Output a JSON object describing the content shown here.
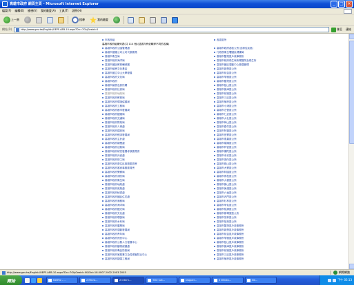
{
  "window": {
    "title": "高雄市政府 網頁主頁 - Microsoft Internet Explorer",
    "controls": [
      "_",
      "□",
      "×"
    ]
  },
  "menu": [
    "檔案(F)",
    "編輯(E)",
    "檢視(V)",
    "我的最愛(A)",
    "工具(T)",
    "說明(H)"
  ],
  "toolbar": {
    "back_label": "上一頁",
    "search_label": "搜尋",
    "favorites_label": "我的最愛"
  },
  "address": {
    "label": "網址(D)",
    "url": "http://www.gov.tw/English/OEPF-AEB-10.aspx?Dn=7GkjGeaid=0",
    "go_label": "移至",
    "links_label": "連結"
  },
  "list": {
    "left": [
      {
        "text": "市政府組",
        "style": "normal"
      },
      {
        "text": "高雄市政府組織列表(共 114 個)(括弧內有依職掌不同的名稱)",
        "style": "head"
      },
      {
        "text": "高雄市政府公園管理處",
        "style": "normal"
      },
      {
        "text": "高雄市捷運公司公司代辦委員",
        "style": "normal"
      },
      {
        "text": "高雄市衛生局",
        "style": "normal"
      },
      {
        "text": "高雄市政府海洋局",
        "style": "normal"
      },
      {
        "text": "高雄市國民教育輔導團",
        "style": "normal"
      },
      {
        "text": "高雄市議會文化基金",
        "style": "normal"
      },
      {
        "text": "高雄市國立中山大學發展",
        "style": "normal"
      },
      {
        "text": "高雄市政府文化局",
        "style": "normal"
      },
      {
        "text": "高雄市政府",
        "style": "normal"
      },
      {
        "text": "高雄市議會及其所屬",
        "style": "normal"
      },
      {
        "text": "高雄市政府社會局",
        "style": "normal"
      },
      {
        "text": "高雄市政府地政局",
        "style": "dim"
      },
      {
        "text": "高雄市政府教育局",
        "style": "normal"
      },
      {
        "text": "高雄市政府環境保護局",
        "style": "normal"
      },
      {
        "text": "高雄市政府工務局",
        "style": "normal"
      },
      {
        "text": "高雄市政府都市發展局",
        "style": "normal"
      },
      {
        "text": "高雄市政府捷運局",
        "style": "normal"
      },
      {
        "text": "高雄市政府交通局",
        "style": "normal"
      },
      {
        "text": "高雄市政府財政局",
        "style": "normal"
      },
      {
        "text": "高雄市政府人事處",
        "style": "normal"
      },
      {
        "text": "高雄市政府建設局",
        "style": "normal"
      },
      {
        "text": "高雄市政府經濟發展局",
        "style": "normal"
      },
      {
        "text": "高雄市政府主計處",
        "style": "normal"
      },
      {
        "text": "高雄市政府新聞處",
        "style": "normal"
      },
      {
        "text": "高雄市政府法制局",
        "style": "normal"
      },
      {
        "text": "高雄市政府研究發展考核委員會",
        "style": "normal"
      },
      {
        "text": "高雄市政府兵役處",
        "style": "normal"
      },
      {
        "text": "高雄市政府勞工局",
        "style": "normal"
      },
      {
        "text": "高雄市政府原住民事務委員會",
        "style": "normal"
      },
      {
        "text": "高雄市政府客家事務委員會",
        "style": "normal"
      },
      {
        "text": "高雄市政府警察局",
        "style": "normal"
      },
      {
        "text": "高雄市政府消防局",
        "style": "normal"
      },
      {
        "text": "高雄市政府衛生局",
        "style": "normal"
      },
      {
        "text": "高雄市政府地政處",
        "style": "normal"
      },
      {
        "text": "高雄市政府政風處",
        "style": "normal"
      },
      {
        "text": "高雄市政府秘書處",
        "style": "normal"
      },
      {
        "text": "高雄市政府國民住宅處",
        "style": "normal"
      },
      {
        "text": "高雄市政府港務局",
        "style": "normal"
      },
      {
        "text": "高雄市政府海洋局",
        "style": "normal"
      },
      {
        "text": "高雄市政府觀光局",
        "style": "normal"
      },
      {
        "text": "高雄市政府文化處",
        "style": "normal"
      },
      {
        "text": "高雄市政府環保局",
        "style": "normal"
      },
      {
        "text": "高雄市政府水利局",
        "style": "normal"
      },
      {
        "text": "高雄市政府農業局",
        "style": "normal"
      },
      {
        "text": "高雄市政府運動發展局",
        "style": "normal"
      },
      {
        "text": "高雄市政府青年局",
        "style": "normal"
      },
      {
        "text": "高雄市政府資訊中心",
        "style": "normal"
      },
      {
        "text": "高雄市政府公務人力發展中心",
        "style": "normal"
      },
      {
        "text": "高雄市政府動物保護處",
        "style": "normal"
      },
      {
        "text": "高雄市政府毒品防制局",
        "style": "normal"
      },
      {
        "text": "高雄市政府家庭暴力及性侵害防治中心",
        "style": "normal"
      },
      {
        "text": "高雄市政府捷運工程局",
        "style": "normal"
      }
    ],
    "right": [
      {
        "text": "各區區所",
        "style": "normal"
      },
      {
        "text": "",
        "style": "spacer"
      },
      {
        "text": "高雄市政府各區公所(含原住民區)",
        "style": "normal"
      },
      {
        "text": "行政院衛生署國民健康局",
        "style": "normal"
      },
      {
        "text": "高雄市鹽埕區戶政事務所",
        "style": "normal"
      },
      {
        "text": "高雄市政府衛生局所屬醫院及衛生所",
        "style": "normal"
      },
      {
        "text": "高雄市國民運動中心營運管理",
        "style": "normal"
      },
      {
        "text": "高雄市新興區公所",
        "style": "normal"
      },
      {
        "text": "高雄市前金區公所",
        "style": "normal"
      },
      {
        "text": "高雄市苓雅區公所",
        "style": "normal"
      },
      {
        "text": "高雄市鹽埕區公所",
        "style": "normal"
      },
      {
        "text": "高雄市鼓山區公所",
        "style": "normal"
      },
      {
        "text": "高雄市旗津區公所",
        "style": "normal"
      },
      {
        "text": "高雄市前鎮區公所",
        "style": "normal"
      },
      {
        "text": "高雄市三民區公所",
        "style": "normal"
      },
      {
        "text": "高雄市楠梓區公所",
        "style": "normal"
      },
      {
        "text": "高雄市小港區公所",
        "style": "normal"
      },
      {
        "text": "高雄市左營區公所",
        "style": "normal"
      },
      {
        "text": "高雄市仁武區公所",
        "style": "normal"
      },
      {
        "text": "高雄市大社區公所",
        "style": "normal"
      },
      {
        "text": "高雄市岡山區公所",
        "style": "normal"
      },
      {
        "text": "高雄市路竹區公所",
        "style": "normal"
      },
      {
        "text": "高雄市阿蓮區公所",
        "style": "normal"
      },
      {
        "text": "高雄市田寮區公所",
        "style": "normal"
      },
      {
        "text": "高雄市燕巢區公所",
        "style": "normal"
      },
      {
        "text": "高雄市橋頭區公所",
        "style": "normal"
      },
      {
        "text": "高雄市梓官區公所",
        "style": "normal"
      },
      {
        "text": "高雄市彌陀區公所",
        "style": "normal"
      },
      {
        "text": "高雄市永安區公所",
        "style": "normal"
      },
      {
        "text": "高雄市湖內區公所",
        "style": "normal"
      },
      {
        "text": "高雄市鳳山區公所",
        "style": "normal"
      },
      {
        "text": "高雄市大寮區公所",
        "style": "normal"
      },
      {
        "text": "高雄市林園區公所",
        "style": "normal"
      },
      {
        "text": "高雄市鳥松區公所",
        "style": "normal"
      },
      {
        "text": "高雄市大樹區公所",
        "style": "normal"
      },
      {
        "text": "高雄市旗山區公所",
        "style": "normal"
      },
      {
        "text": "高雄市美濃區公所",
        "style": "normal"
      },
      {
        "text": "高雄市六龜區公所",
        "style": "normal"
      },
      {
        "text": "高雄市內門區公所",
        "style": "normal"
      },
      {
        "text": "高雄市杉林區公所",
        "style": "normal"
      },
      {
        "text": "高雄市甲仙區公所",
        "style": "normal"
      },
      {
        "text": "高雄市桃源區公所",
        "style": "normal"
      },
      {
        "text": "高雄市那瑪夏區公所",
        "style": "normal"
      },
      {
        "text": "高雄市茂林區公所",
        "style": "normal"
      },
      {
        "text": "高雄市茄萣區公所",
        "style": "normal"
      },
      {
        "text": "高雄市鹽埕區戶政事務所",
        "style": "normal"
      },
      {
        "text": "高雄市新興區戶政事務所",
        "style": "normal"
      },
      {
        "text": "高雄市前金區戶政事務所",
        "style": "normal"
      },
      {
        "text": "高雄市苓雅區戶政事務所",
        "style": "normal"
      },
      {
        "text": "高雄市鼓山區戶政事務所",
        "style": "normal"
      },
      {
        "text": "高雄市旗津區戶政事務所",
        "style": "normal"
      },
      {
        "text": "高雄市前鎮區戶政事務所",
        "style": "normal"
      },
      {
        "text": "高雄市三民區戶政事務所",
        "style": "normal"
      },
      {
        "text": "高雄市楠梓區戶政事務所",
        "style": "normal"
      }
    ]
  },
  "status": {
    "text": "http://www.gov.tw/English/OEPF-AEB-10.aspx?Dn=7GkjGeaid=0&GId=18.0007.2002.2003.2003",
    "zone": "網際網路"
  },
  "taskbar": {
    "start_label": "開始",
    "tasks": [
      "Netflix - ...",
      "2 Micro...",
      "2 Intern...",
      "Tree Cat...",
      "Dopper...",
      "3 Windo...",
      "Ne..."
    ],
    "clock": "下午 03:13"
  }
}
